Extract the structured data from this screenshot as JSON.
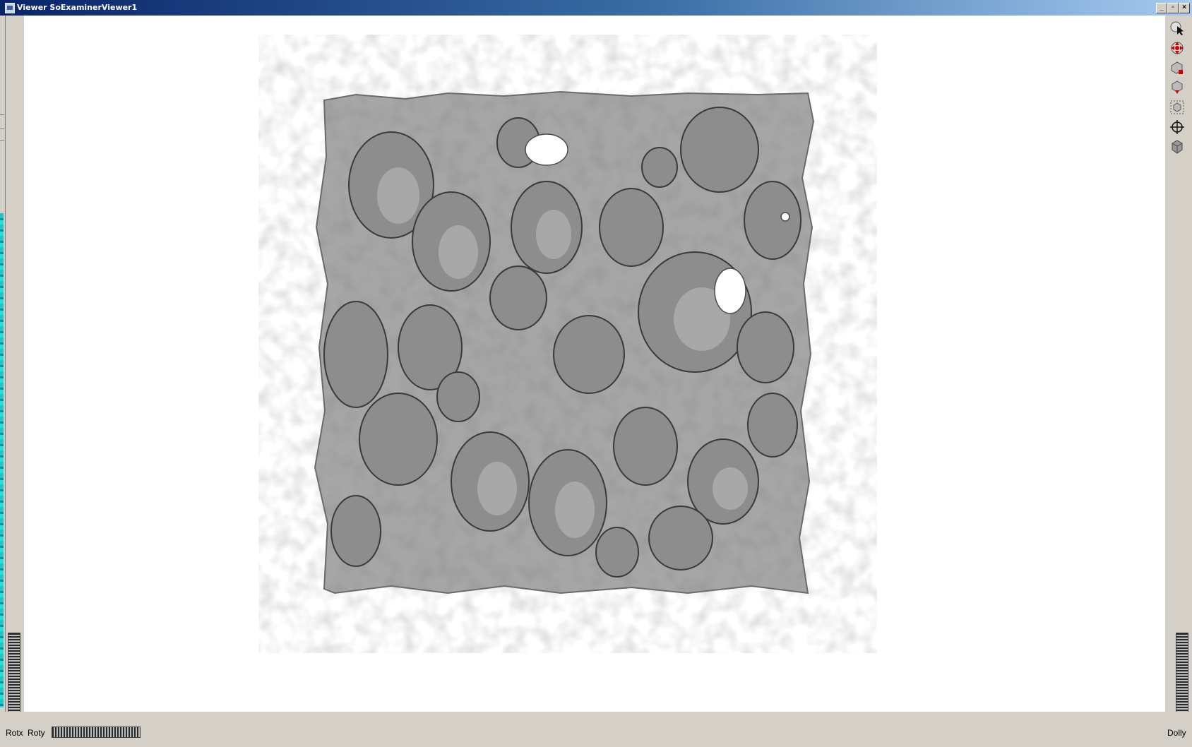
{
  "window": {
    "title": "Viewer SoExaminerViewer1"
  },
  "viewer": {
    "bottom_labels": {
      "rotx": "Rotx",
      "roty": "Roty",
      "dolly": "Dolly"
    },
    "tools": [
      "pick-arrow-icon",
      "view-hand-icon",
      "home-icon",
      "set-home-icon",
      "view-all-icon",
      "seek-icon",
      "camera-icon"
    ]
  },
  "colors": {
    "background": "#ffffff",
    "surface": "#a8a8a8",
    "chrome": "#d4d0c8",
    "titlebar": "#0a246a"
  }
}
